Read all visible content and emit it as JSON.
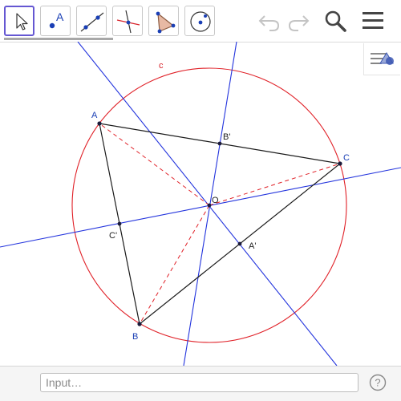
{
  "toolbar": {
    "tools": [
      {
        "id": "move-tool",
        "glyph_label": ""
      },
      {
        "id": "point-tool",
        "glyph_label": "A"
      },
      {
        "id": "line-tool",
        "glyph_label": ""
      },
      {
        "id": "perpendicular-tool",
        "glyph_label": ""
      },
      {
        "id": "polygon-tool",
        "glyph_label": ""
      },
      {
        "id": "circle-tool",
        "glyph_label": ""
      }
    ],
    "selected_tool": "move-tool",
    "controls": [
      "undo",
      "redo",
      "search",
      "menu"
    ]
  },
  "construction": {
    "labels": {
      "A": "A",
      "B": "B",
      "C": "C",
      "B_prime": "B'",
      "C_prime": "C'",
      "A_prime": "A'",
      "O": "O",
      "c": "c"
    }
  },
  "colors": {
    "triangle": "#1a1a1a",
    "circle": "#e01f26",
    "bisectors": "#2233dd",
    "radii_dashed": "#e01f26",
    "points": "#1a1a3a",
    "selected_tool_border": "#6557d2"
  },
  "input_bar": {
    "placeholder": "Input…",
    "value": ""
  },
  "help": {
    "symbol": "?"
  }
}
